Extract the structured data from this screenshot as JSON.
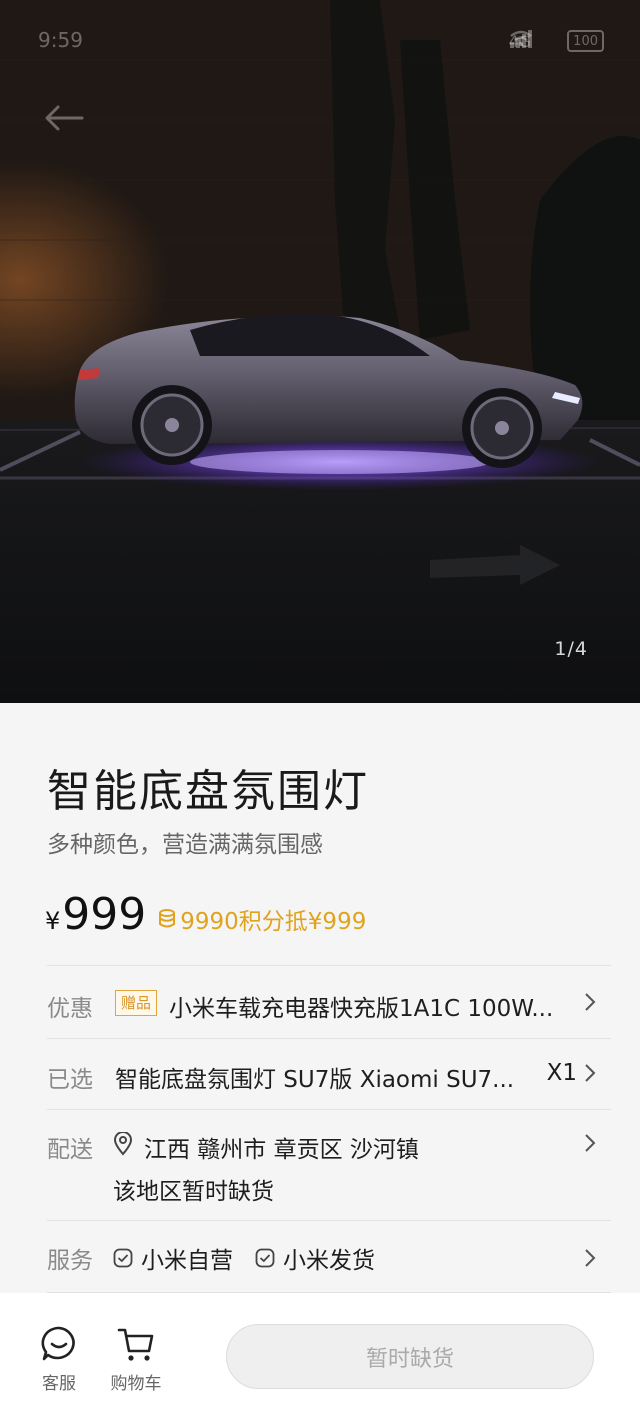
{
  "status_bar": {
    "time": "9:59",
    "network": "4G",
    "battery": "100"
  },
  "gallery": {
    "counter": "1/4"
  },
  "product": {
    "title": "智能底盘氛围灯",
    "subtitle": "多种颜色，营造满满氛围感",
    "price_currency": "¥",
    "price": "999",
    "points_text": "9990积分抵¥999"
  },
  "promo": {
    "label": "优惠",
    "tag": "赠品",
    "text": "小米车载充电器快充版1A1C 100W..."
  },
  "selected": {
    "label": "已选",
    "text": "智能底盘氛围灯 SU7版  Xiaomi SU7...",
    "qty": "X1"
  },
  "delivery": {
    "label": "配送",
    "address": "江西 赣州市 章贡区 沙河镇",
    "stock_note": "该地区暂时缺货"
  },
  "service": {
    "label": "服务",
    "items": [
      "小米自营",
      "小米发货"
    ]
  },
  "bottom_bar": {
    "support_label": "客服",
    "cart_label": "购物车",
    "primary_button": "暂时缺货"
  },
  "colors": {
    "accent_gold": "#e0a31e",
    "underglow": "#8a55ff"
  }
}
